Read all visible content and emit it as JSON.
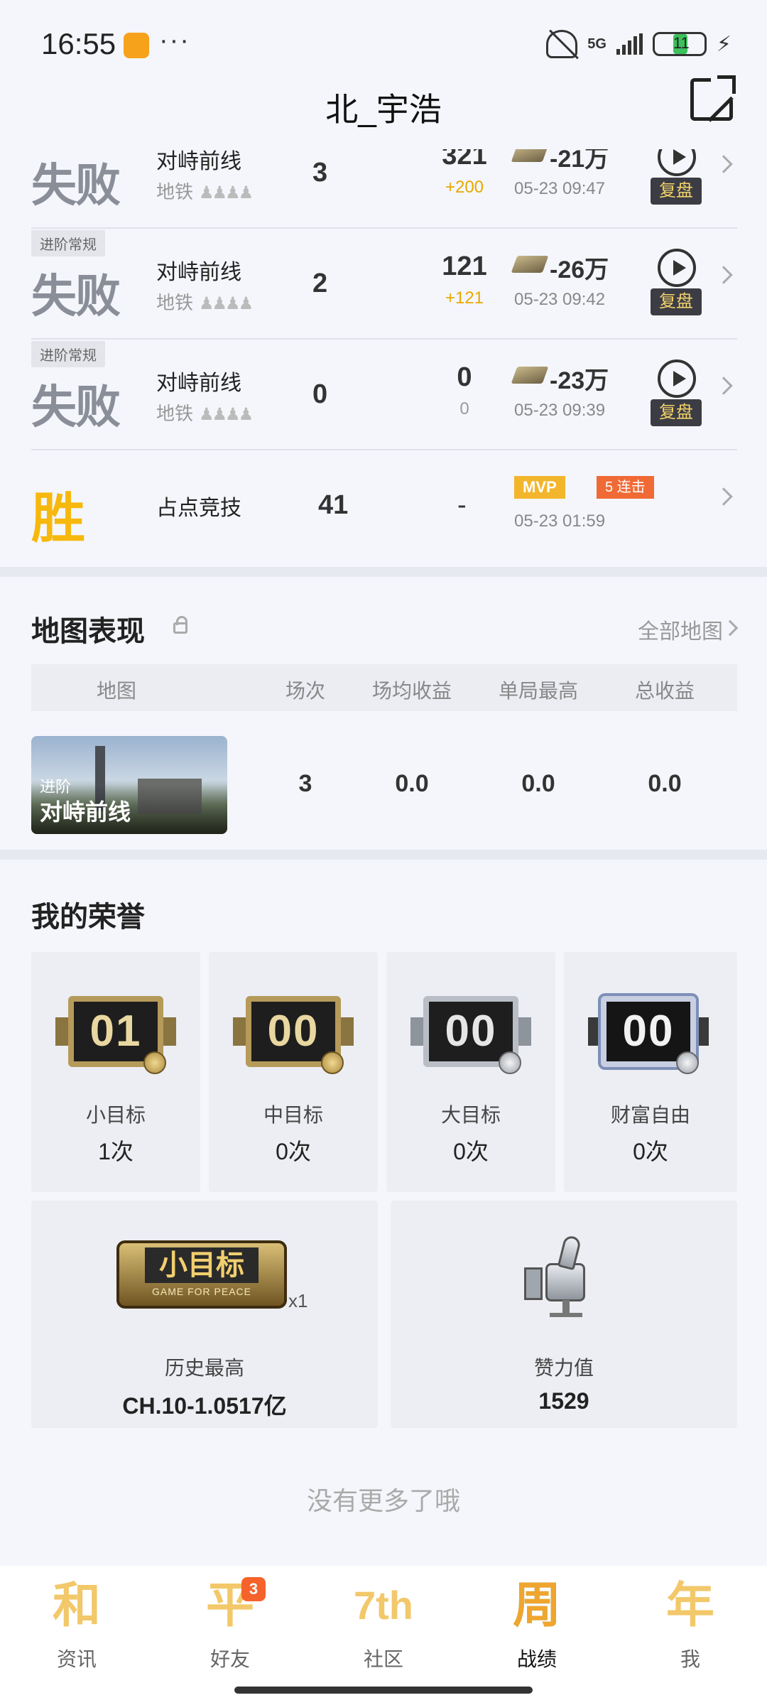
{
  "status_bar": {
    "time": "16:55",
    "network": "5G",
    "battery": "11"
  },
  "header": {
    "title": "北_宇浩"
  },
  "matches": [
    {
      "tag": "",
      "result": "失败",
      "mode": "对峙前线",
      "map": "地铁",
      "kills": "3",
      "score": "321",
      "score_delta": "+200",
      "money": "-21万",
      "time": "05-23 09:47",
      "replay_label": "复盘"
    },
    {
      "tag": "进阶常规",
      "result": "失败",
      "mode": "对峙前线",
      "map": "地铁",
      "kills": "2",
      "score": "121",
      "score_delta": "+121",
      "money": "-26万",
      "time": "05-23 09:42",
      "replay_label": "复盘"
    },
    {
      "tag": "进阶常规",
      "result": "失败",
      "mode": "对峙前线",
      "map": "地铁",
      "kills": "0",
      "score": "0",
      "score_delta": "0",
      "money": "-23万",
      "time": "05-23 09:39",
      "replay_label": "复盘"
    },
    {
      "tag": "",
      "result": "胜",
      "mode": "占点竞技",
      "map": "",
      "kills": "41",
      "score": "-",
      "mvp": "MVP",
      "streak": "5 连击",
      "time": "05-23 01:59"
    }
  ],
  "map_performance": {
    "title": "地图表现",
    "all_maps_link": "全部地图",
    "columns": [
      "地图",
      "场次",
      "场均收益",
      "单局最高",
      "总收益"
    ],
    "rows": [
      {
        "tag": "进阶",
        "map": "对峙前线",
        "games": "3",
        "avg": "0.0",
        "best": "0.0",
        "total": "0.0"
      }
    ]
  },
  "honors": {
    "title": "我的荣誉",
    "badges": [
      {
        "label": "小目标",
        "count": "1次",
        "badge_number": "01",
        "style": "gold"
      },
      {
        "label": "中目标",
        "count": "0次",
        "badge_number": "00",
        "style": "gold"
      },
      {
        "label": "大目标",
        "count": "0次",
        "badge_number": "00",
        "style": "silver"
      },
      {
        "label": "财富自由",
        "count": "0次",
        "badge_number": "00",
        "style": "holo"
      }
    ],
    "history": {
      "badge_text": "小目标",
      "badge_sub": "GAME FOR PEACE",
      "multiplier": "x1",
      "label": "历史最高",
      "value": "CH.10-1.0517亿"
    },
    "likes": {
      "label": "赞力值",
      "value": "1529"
    }
  },
  "footer_text": "没有更多了哦",
  "nav": [
    {
      "icon_char": "和",
      "label": "资讯",
      "active": false
    },
    {
      "icon_char": "平",
      "label": "好友",
      "badge": "3",
      "active": false
    },
    {
      "icon_char": "7th",
      "label": "社区",
      "active": false
    },
    {
      "icon_char": "周",
      "label": "战绩",
      "active": true
    },
    {
      "icon_char": "年",
      "label": "我",
      "active": false
    }
  ],
  "colors": {
    "win": "#f7b80d",
    "loss": "#8a8e98",
    "score_delta": "#e8a800",
    "mvp": "#f3b52c",
    "streak": "#f06a35",
    "badge": "#f5632a"
  }
}
